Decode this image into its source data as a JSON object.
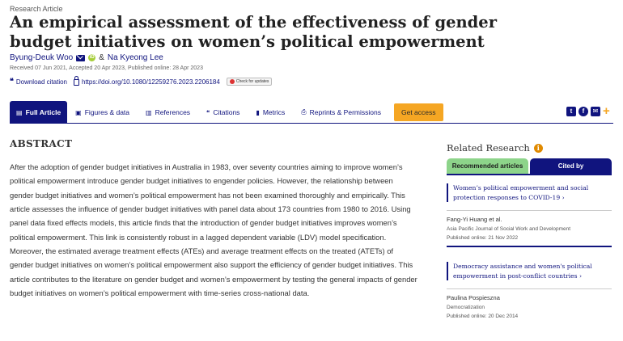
{
  "article": {
    "type": "Research Article",
    "title": "An empirical assessment of the effectiveness of gender budget initiatives on women’s political empowerment",
    "author1": "Byung-Deuk Woo",
    "amp": "&",
    "author2": "Na Kyeong Lee",
    "dates": "Received 07 Jun 2021, Accepted 20 Apr 2023, Published online: 28 Apr 2023",
    "download_citation": "Download citation",
    "doi": "https://doi.org/10.1080/12259276.2023.2206184",
    "check_updates": "Check for updates"
  },
  "tabs": {
    "full_article": "Full Article",
    "figures": "Figures & data",
    "references": "References",
    "citations": "Citations",
    "metrics": "Metrics",
    "reprints": "Reprints & Permissions",
    "get_access": "Get access"
  },
  "share": {
    "twitter": "t",
    "facebook": "f",
    "email": "✉",
    "plus": "+"
  },
  "abstract": {
    "heading": "ABSTRACT",
    "body": "After the adoption of gender budget initiatives in Australia in 1983, over seventy countries aiming to improve women’s political empowerment introduce gender budget initiatives to engender policies. However, the relationship between gender budget initiatives and women’s political empowerment has not been examined thoroughly and empirically. This article assesses the influence of gender budget initiatives with panel data about 173 countries from 1980 to 2016. Using panel data fixed effects models, this article finds that the introduction of gender budget initiatives improves women’s political empowerment. This link is consistently robust in a lagged dependent variable (LDV) model specification. Moreover, the estimated average treatment effects (ATEs) and average treatment effects on the treated (ATETs) of gender budget initiatives on women’s political empowerment also support the efficiency of gender budget initiatives. This article contributes to the literature on gender budget and women’s empowerment by testing the general impacts of gender budget initiatives on women’s political empowerment with time-series cross-national data."
  },
  "related": {
    "heading": "Related Research",
    "tab_recommended": "Recommended articles",
    "tab_cited": "Cited by",
    "items": [
      {
        "title": "Women’s political empowerment and social protection responses to COVID-19",
        "author": "Fang-Yi Huang et al.",
        "journal": "Asia Pacific Journal of Social Work and Development",
        "date": "Published online: 21 Nov 2022"
      },
      {
        "title": "Democracy assistance and women's political empowerment in post-conflict countries",
        "author": "Paulina Pospieszna",
        "journal": "Democratization",
        "date": "Published online: 20 Dec 2014"
      }
    ]
  },
  "colors": {
    "brand_navy": "#10147e",
    "accent_orange": "#f5a623",
    "recommended_green": "#8dd48a"
  }
}
